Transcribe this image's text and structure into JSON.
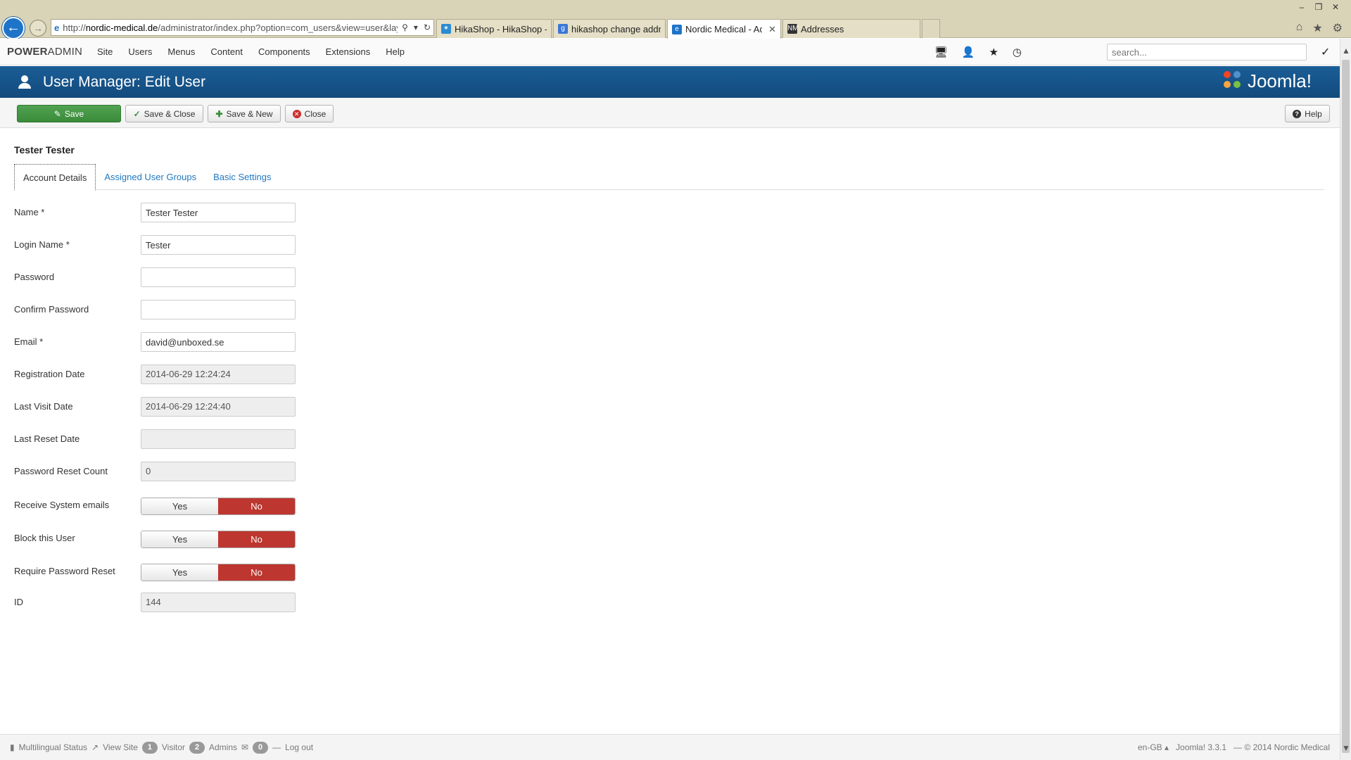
{
  "browser": {
    "url_prefix": "http://",
    "url_host": "nordic-medical.de",
    "url_rest": "/administrator/index.php?option=com_users&view=user&layo",
    "tabs": [
      {
        "title": "HikaShop - HikaShop - New T...",
        "icon": "hikashop-favicon",
        "color": "#2a8bd3",
        "active": false
      },
      {
        "title": "hikashop change address - Go...",
        "icon": "google-favicon",
        "color": "#3b77d8",
        "active": false
      },
      {
        "title": "Nordic Medical - Administr...",
        "icon": "ie-favicon",
        "color": "#1e74c8",
        "active": true
      },
      {
        "title": "Addresses",
        "icon": "nm-favicon",
        "color": "#333333",
        "active": false
      }
    ],
    "nm_icon_text": "NM"
  },
  "navbar": {
    "brand_bold": "POWER",
    "brand_rest": "ADMIN",
    "menu": [
      "Site",
      "Users",
      "Menus",
      "Content",
      "Components",
      "Extensions",
      "Help"
    ],
    "search_placeholder": "search..."
  },
  "header": {
    "title": "User Manager: Edit User",
    "logo_text": "Joomla!"
  },
  "toolbar": {
    "save": "Save",
    "save_close": "Save & Close",
    "save_new": "Save & New",
    "close": "Close",
    "help": "Help"
  },
  "record": {
    "title": "Tester Tester"
  },
  "tabs": [
    "Account Details",
    "Assigned User Groups",
    "Basic Settings"
  ],
  "form": {
    "name_label": "Name *",
    "name_value": "Tester Tester",
    "login_label": "Login Name *",
    "login_value": "Tester",
    "password_label": "Password",
    "confirm_label": "Confirm Password",
    "email_label": "Email *",
    "email_value": "david@unboxed.se",
    "reg_label": "Registration Date",
    "reg_value": "2014-06-29 12:24:24",
    "visit_label": "Last Visit Date",
    "visit_value": "2014-06-29 12:24:40",
    "reset_label": "Last Reset Date",
    "reset_value": "",
    "reset_count_label": "Password Reset Count",
    "reset_count_value": "0",
    "sys_email_label": "Receive System emails",
    "block_label": "Block this User",
    "require_reset_label": "Require Password Reset",
    "yes": "Yes",
    "no": "No",
    "id_label": "ID",
    "id_value": "144"
  },
  "footer": {
    "multilingual": "Multilingual Status",
    "view_site": "View Site",
    "visitor_count": "1",
    "visitor_label": "Visitor",
    "admin_count": "2",
    "admin_label": "Admins",
    "msg_count": "0",
    "logout": "Log out",
    "lang": "en-GB",
    "version": "Joomla! 3.3.1",
    "copyright": "— © 2014 Nordic Medical"
  },
  "colors": {
    "header_blue": "#17568c",
    "save_green": "#51a351",
    "toggle_red": "#bd362f",
    "link_blue": "#1f78c1"
  }
}
